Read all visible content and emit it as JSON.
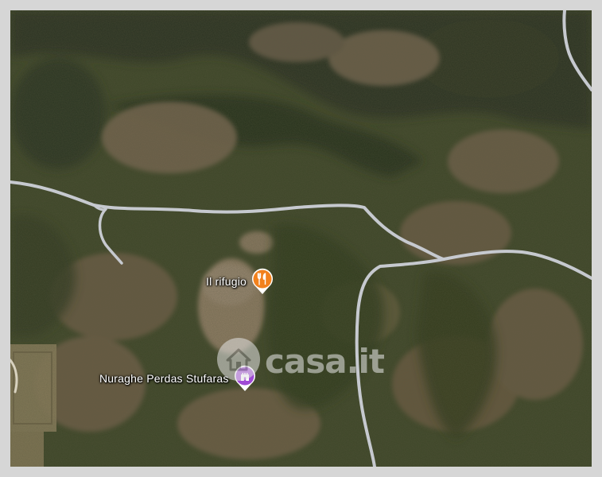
{
  "map": {
    "type": "satellite",
    "pois": [
      {
        "label": "Il rifugio",
        "icon": "restaurant-fork-knife-icon",
        "color": "#f2811d"
      },
      {
        "label": "Nuraghe Perdas Stufaras",
        "icon": "castle-tower-icon",
        "color": "#a04ad6"
      }
    ],
    "watermark": {
      "text": "casa.it",
      "icon": "house-icon"
    }
  },
  "colors": {
    "frame": "#d6d6d6",
    "road": "#c9ccd3",
    "forest_dark": "#2f3820",
    "forest": "#3e4a26",
    "rock": "#7a6a55",
    "field": "#8c7a5c"
  }
}
